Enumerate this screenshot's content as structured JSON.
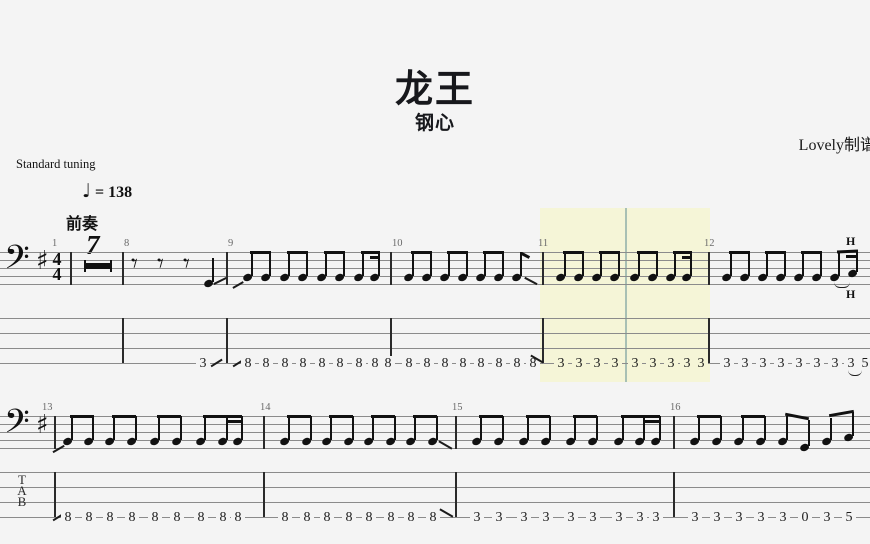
{
  "header": {
    "title": "龙王",
    "subtitle": "钢心",
    "credit": "Lovely制谱",
    "tuning": "Standard tuning",
    "tempo_note": "♩",
    "tempo_text": "= 138",
    "section_label": "前奏",
    "multirest_count": "7"
  },
  "staff_meta": {
    "clef": "bass-clef",
    "clef_glyph": "𝄢",
    "key_signature": "♯",
    "time_top": "4",
    "time_bottom": "4",
    "tab_label_lines": [
      "T",
      "A",
      "B"
    ]
  },
  "systems": [
    {
      "index": 1,
      "measures": [
        {
          "number": "1",
          "type": "multimeasure-rest",
          "rest_count": "7",
          "tab": []
        },
        {
          "number": "8",
          "type": "notes",
          "rests": [
            "quarter",
            "quarter",
            "quarter"
          ],
          "tab": [
            "3"
          ],
          "articulations": [
            "slide-out"
          ]
        },
        {
          "number": "9",
          "type": "notes",
          "tab": [
            "8",
            "8",
            "8",
            "8",
            "8",
            "8",
            "8",
            "8",
            "8"
          ],
          "articulations": [
            "slide-in"
          ]
        },
        {
          "number": "10",
          "type": "notes",
          "tab": [
            "8",
            "8",
            "8",
            "8",
            "8",
            "8",
            "8",
            "8"
          ],
          "articulations": [
            "slide-out-down"
          ]
        },
        {
          "number": "11",
          "type": "notes",
          "highlighted": true,
          "tab": [
            "3",
            "3",
            "3",
            "3",
            "3",
            "3",
            "3",
            "3",
            "3"
          ],
          "articulations": []
        },
        {
          "number": "12",
          "type": "notes",
          "tab": [
            "3",
            "3",
            "3",
            "3",
            "3",
            "3",
            "3",
            "3",
            "5"
          ],
          "articulations": [
            "hammer-on"
          ],
          "technique_marks": [
            "H",
            "H"
          ]
        }
      ]
    },
    {
      "index": 2,
      "measures": [
        {
          "number": "13",
          "type": "notes",
          "tab": [
            "8",
            "8",
            "8",
            "8",
            "8",
            "8",
            "8",
            "8",
            "8"
          ],
          "articulations": [
            "slide-in"
          ]
        },
        {
          "number": "14",
          "type": "notes",
          "tab": [
            "8",
            "8",
            "8",
            "8",
            "8",
            "8",
            "8",
            "8"
          ],
          "articulations": [
            "slide-out-down"
          ]
        },
        {
          "number": "15",
          "type": "notes",
          "tab": [
            "3",
            "3",
            "3",
            "3",
            "3",
            "3",
            "3",
            "3",
            "3"
          ],
          "articulations": []
        },
        {
          "number": "16",
          "type": "notes",
          "tab": [
            "3",
            "3",
            "3",
            "3",
            "3",
            "0",
            "3",
            "5"
          ],
          "articulations": []
        }
      ]
    }
  ],
  "playback": {
    "highlight_measure": "11",
    "cursor_measure": "11",
    "highlight_color": "#f5f5d7",
    "cursor_color": "#a8c0b4"
  },
  "colors": {
    "page_background": "#f4f4f4",
    "staff_line": "#8b8b8b",
    "ink": "#111111"
  }
}
